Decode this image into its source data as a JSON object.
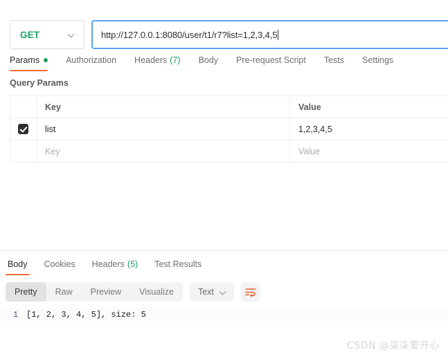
{
  "request": {
    "method": "GET",
    "url": "http://127.0.0.1:8080/user/t1/r7?list=1,2,3,4,5",
    "tabs": [
      {
        "label": "Params",
        "active": true,
        "dot": true
      },
      {
        "label": "Authorization",
        "active": false
      },
      {
        "label": "Headers",
        "count": "(7)",
        "active": false
      },
      {
        "label": "Body",
        "active": false
      },
      {
        "label": "Pre-request Script",
        "active": false
      },
      {
        "label": "Tests",
        "active": false
      },
      {
        "label": "Settings",
        "active": false
      }
    ]
  },
  "query_params": {
    "section_title": "Query Params",
    "headers": {
      "key": "Key",
      "value": "Value"
    },
    "rows": [
      {
        "checked": true,
        "key": "list",
        "value": "1,2,3,4,5"
      },
      {
        "checked": false,
        "key": "Key",
        "value": "Value",
        "placeholder": true
      }
    ]
  },
  "response": {
    "tabs": [
      {
        "label": "Body",
        "active": true
      },
      {
        "label": "Cookies",
        "active": false
      },
      {
        "label": "Headers",
        "count": "(5)",
        "active": false
      },
      {
        "label": "Test Results",
        "active": false
      }
    ],
    "view_modes": [
      "Pretty",
      "Raw",
      "Preview",
      "Visualize"
    ],
    "active_view_mode": "Pretty",
    "content_type": "Text",
    "body_lines": [
      {
        "number": "1",
        "text": "[1, 2, 3, 4, 5], size: 5"
      }
    ]
  },
  "watermark": "CSDN @柒柒要开心",
  "colors": {
    "method_green": "#1aa260",
    "accent_orange": "#f26b3a",
    "focus_blue": "#5aa3f0"
  }
}
